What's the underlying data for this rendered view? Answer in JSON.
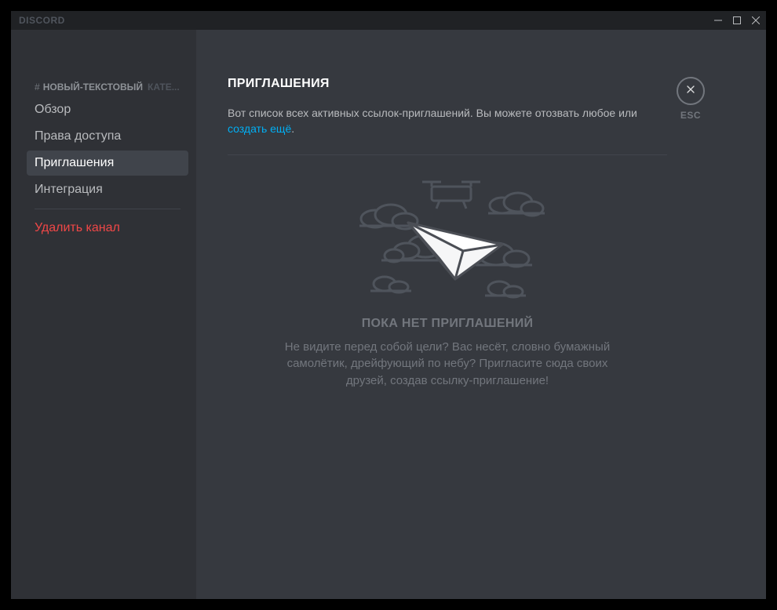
{
  "titlebar": {
    "app_name": "DISCORD"
  },
  "sidebar": {
    "channel_name": "НОВЫЙ-ТЕКСТОВЫЙ",
    "category_label": "КАТЕ...",
    "items": [
      {
        "label": "Обзор"
      },
      {
        "label": "Права доступа"
      },
      {
        "label": "Приглашения"
      },
      {
        "label": "Интеграция"
      }
    ],
    "delete_label": "Удалить канал"
  },
  "main": {
    "title": "ПРИГЛАШЕНИЯ",
    "desc_prefix": "Вот список всех активных ссылок-приглашений. Вы можете отозвать любое или ",
    "desc_link": "создать ещё",
    "desc_suffix": "."
  },
  "empty": {
    "title": "ПОКА НЕТ ПРИГЛАШЕНИЙ",
    "body": "Не видите перед собой цели? Вас несёт, словно бумажный самолётик, дрейфующий по небу? Пригласите сюда своих друзей, создав ссылку-приглашение!"
  },
  "close": {
    "esc": "ESC"
  }
}
